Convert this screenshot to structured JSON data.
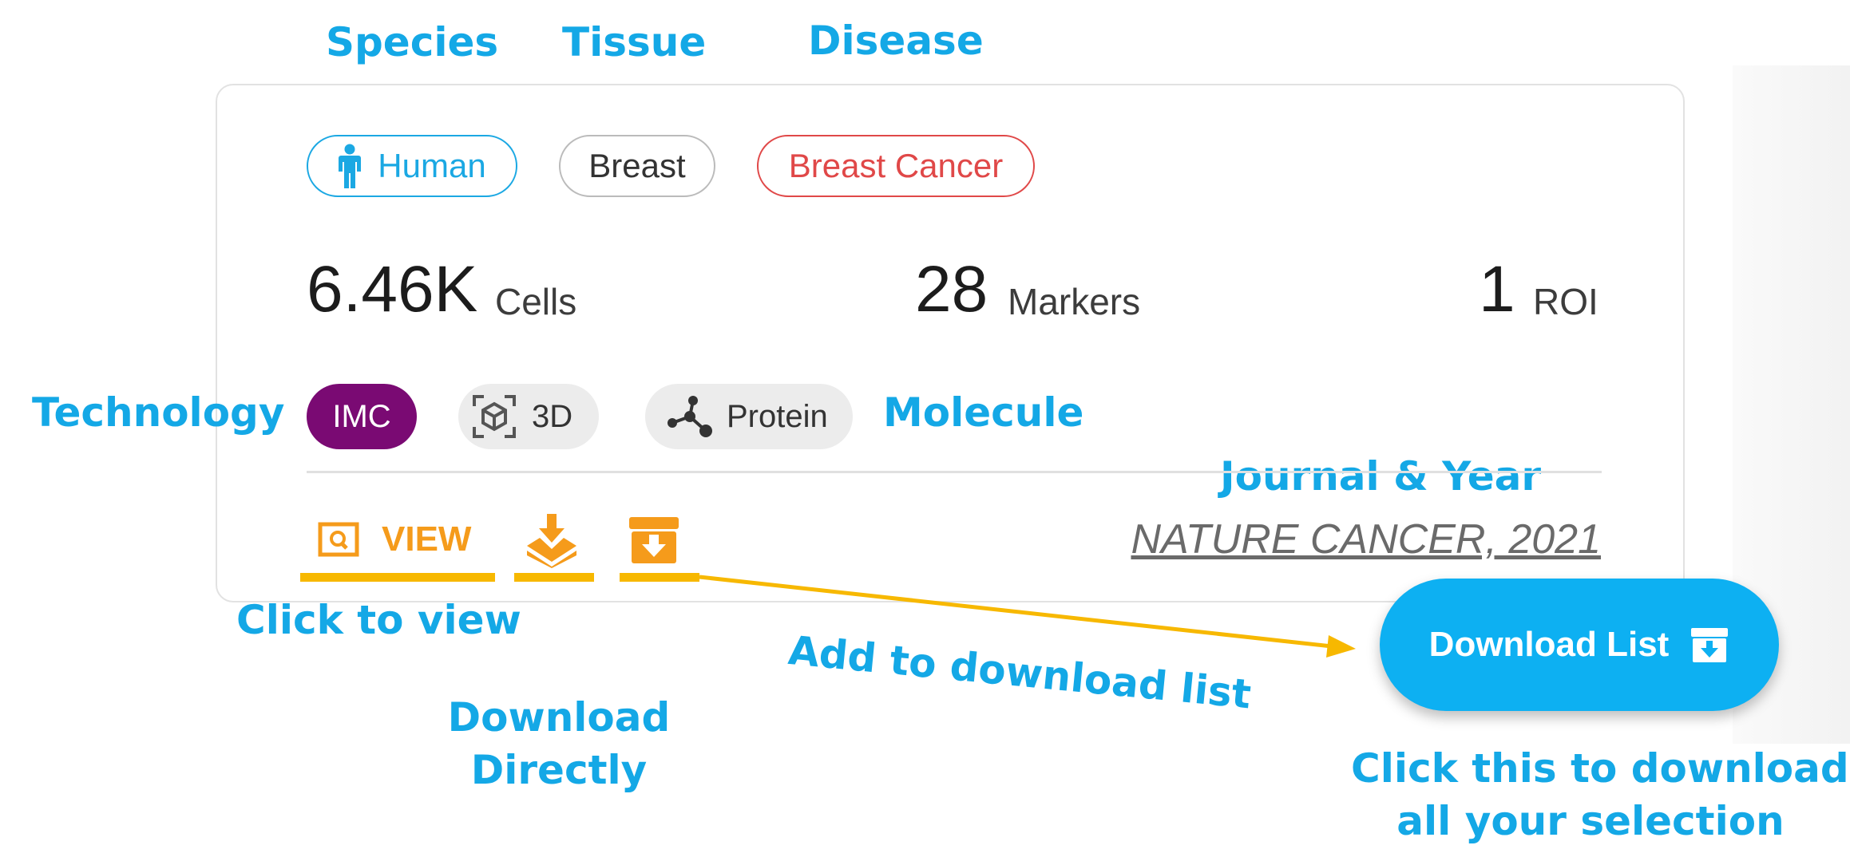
{
  "annotations": {
    "species": "Species",
    "tissue": "Tissue",
    "disease": "Disease",
    "technology": "Technology",
    "molecule": "Molecule",
    "journal_year": "Journal & Year",
    "click_to_view": "Click to view",
    "add_to_download_list": "Add to download list",
    "download_directly_1": "Download",
    "download_directly_2": "Directly",
    "click_download_1": "Click this to download",
    "click_download_2": "all your selection"
  },
  "card": {
    "species_tag": "Human",
    "tissue_tag": "Breast",
    "disease_tag": "Breast Cancer",
    "stats": [
      {
        "value": "6.46K",
        "unit": "Cells"
      },
      {
        "value": "28",
        "unit": "Markers"
      },
      {
        "value": "1",
        "unit": "ROI"
      }
    ],
    "technology_chip": "IMC",
    "dimension_chip": "3D",
    "molecule_chip": "Protein",
    "view_label": "VIEW",
    "journal": "NATURE CANCER, 2021"
  },
  "download_list_button": "Download List",
  "icons": [
    "person-icon",
    "cube-3d-icon",
    "molecule-icon",
    "view-icon",
    "download-icon",
    "add-to-list-icon",
    "archive-download-icon"
  ],
  "colors": {
    "annotation": "#14a8e6",
    "species": "#1ba8e3",
    "disease": "#e04848",
    "technology": "#7a0a73",
    "action": "#f59b1b",
    "highlight": "#f7b800",
    "download_button": "#0db0f2"
  }
}
